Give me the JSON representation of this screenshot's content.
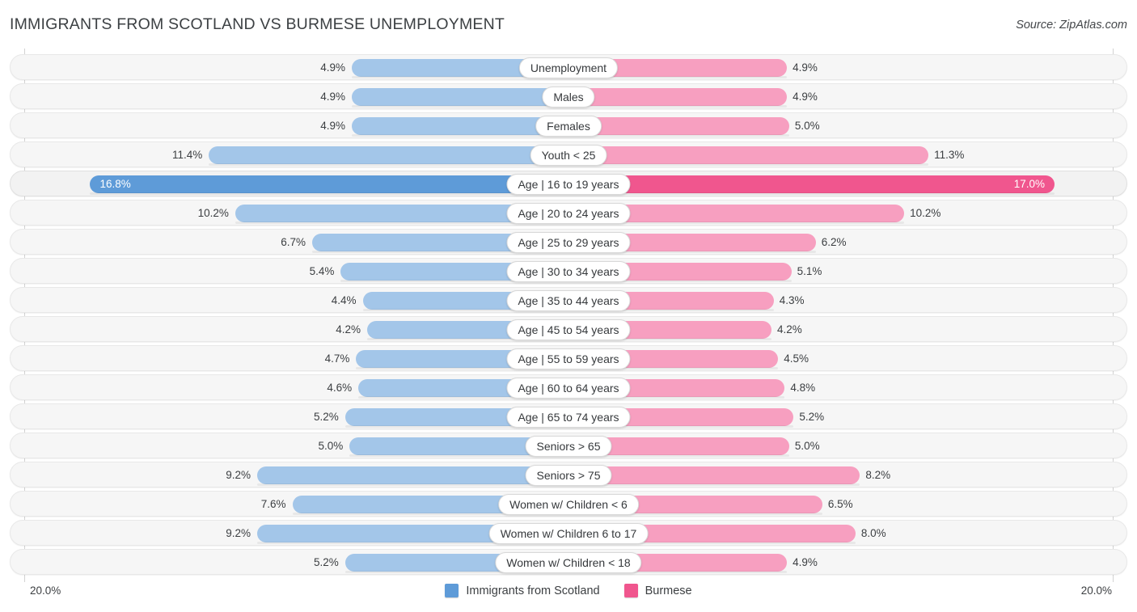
{
  "header": {
    "title": "IMMIGRANTS FROM SCOTLAND VS BURMESE UNEMPLOYMENT",
    "source": "Source: ZipAtlas.com"
  },
  "legend": {
    "position": "bottom-center",
    "items": [
      {
        "label": "Immigrants from Scotland",
        "color": "#5e9bd8",
        "swatch": "blue"
      },
      {
        "label": "Burmese",
        "color": "#f0568e",
        "swatch": "pink"
      }
    ]
  },
  "axis": {
    "left_label": "20.0%",
    "right_label": "20.0%",
    "max": 20.0,
    "unit": "%"
  },
  "colors": {
    "left_bar": "#a3c6e9",
    "right_bar": "#f79fc0",
    "left_bar_highlight": "#5e9bd8",
    "right_bar_highlight": "#f0568e",
    "row_background": "#f6f6f6",
    "page_background": "#ffffff",
    "text": "#3b3e41"
  },
  "chart_data": {
    "type": "bar",
    "subtype": "diverging-bidirectional",
    "title": "IMMIGRANTS FROM SCOTLAND VS BURMESE UNEMPLOYMENT",
    "xlabel": "",
    "ylabel": "",
    "xlim": [
      20.0,
      20.0
    ],
    "grid": false,
    "legend_position": "bottom-center",
    "categories": [
      "Unemployment",
      "Males",
      "Females",
      "Youth < 25",
      "Age | 16 to 19 years",
      "Age | 20 to 24 years",
      "Age | 25 to 29 years",
      "Age | 30 to 34 years",
      "Age | 35 to 44 years",
      "Age | 45 to 54 years",
      "Age | 55 to 59 years",
      "Age | 60 to 64 years",
      "Age | 65 to 74 years",
      "Seniors > 65",
      "Seniors > 75",
      "Women w/ Children < 6",
      "Women w/ Children 6 to 17",
      "Women w/ Children < 18"
    ],
    "series": [
      {
        "name": "Immigrants from Scotland",
        "color": "#5e9bd8",
        "values": [
          4.9,
          4.9,
          4.9,
          11.4,
          16.8,
          10.2,
          6.7,
          5.4,
          4.4,
          4.2,
          4.7,
          4.6,
          5.2,
          5.0,
          9.2,
          7.6,
          9.2,
          5.2
        ]
      },
      {
        "name": "Burmese",
        "color": "#f0568e",
        "values": [
          4.9,
          4.9,
          5.0,
          11.3,
          17.0,
          10.2,
          6.2,
          5.1,
          4.3,
          4.2,
          4.5,
          4.8,
          5.2,
          5.0,
          8.2,
          6.5,
          8.0,
          4.9
        ]
      }
    ]
  },
  "rows": [
    {
      "label": "Unemployment",
      "left": "4.9%",
      "right": "4.9%",
      "lv": 4.9,
      "rv": 4.9,
      "highlight": false
    },
    {
      "label": "Males",
      "left": "4.9%",
      "right": "4.9%",
      "lv": 4.9,
      "rv": 4.9,
      "highlight": false
    },
    {
      "label": "Females",
      "left": "4.9%",
      "right": "5.0%",
      "lv": 4.9,
      "rv": 5.0,
      "highlight": false
    },
    {
      "label": "Youth < 25",
      "left": "11.4%",
      "right": "11.3%",
      "lv": 11.4,
      "rv": 11.3,
      "highlight": false
    },
    {
      "label": "Age | 16 to 19 years",
      "left": "16.8%",
      "right": "17.0%",
      "lv": 16.8,
      "rv": 17.0,
      "highlight": true
    },
    {
      "label": "Age | 20 to 24 years",
      "left": "10.2%",
      "right": "10.2%",
      "lv": 10.2,
      "rv": 10.2,
      "highlight": false
    },
    {
      "label": "Age | 25 to 29 years",
      "left": "6.7%",
      "right": "6.2%",
      "lv": 6.7,
      "rv": 6.2,
      "highlight": false
    },
    {
      "label": "Age | 30 to 34 years",
      "left": "5.4%",
      "right": "5.1%",
      "lv": 5.4,
      "rv": 5.1,
      "highlight": false
    },
    {
      "label": "Age | 35 to 44 years",
      "left": "4.4%",
      "right": "4.3%",
      "lv": 4.4,
      "rv": 4.3,
      "highlight": false
    },
    {
      "label": "Age | 45 to 54 years",
      "left": "4.2%",
      "right": "4.2%",
      "lv": 4.2,
      "rv": 4.2,
      "highlight": false
    },
    {
      "label": "Age | 55 to 59 years",
      "left": "4.7%",
      "right": "4.5%",
      "lv": 4.7,
      "rv": 4.5,
      "highlight": false
    },
    {
      "label": "Age | 60 to 64 years",
      "left": "4.6%",
      "right": "4.8%",
      "lv": 4.6,
      "rv": 4.8,
      "highlight": false
    },
    {
      "label": "Age | 65 to 74 years",
      "left": "5.2%",
      "right": "5.2%",
      "lv": 5.2,
      "rv": 5.2,
      "highlight": false
    },
    {
      "label": "Seniors > 65",
      "left": "5.0%",
      "right": "5.0%",
      "lv": 5.0,
      "rv": 5.0,
      "highlight": false
    },
    {
      "label": "Seniors > 75",
      "left": "9.2%",
      "right": "8.2%",
      "lv": 9.2,
      "rv": 8.2,
      "highlight": false
    },
    {
      "label": "Women w/ Children < 6",
      "left": "7.6%",
      "right": "6.5%",
      "lv": 7.6,
      "rv": 6.5,
      "highlight": false
    },
    {
      "label": "Women w/ Children 6 to 17",
      "left": "9.2%",
      "right": "8.0%",
      "lv": 9.2,
      "rv": 8.0,
      "highlight": false
    },
    {
      "label": "Women w/ Children < 18",
      "left": "5.2%",
      "right": "4.9%",
      "lv": 5.2,
      "rv": 4.9,
      "highlight": false
    }
  ]
}
